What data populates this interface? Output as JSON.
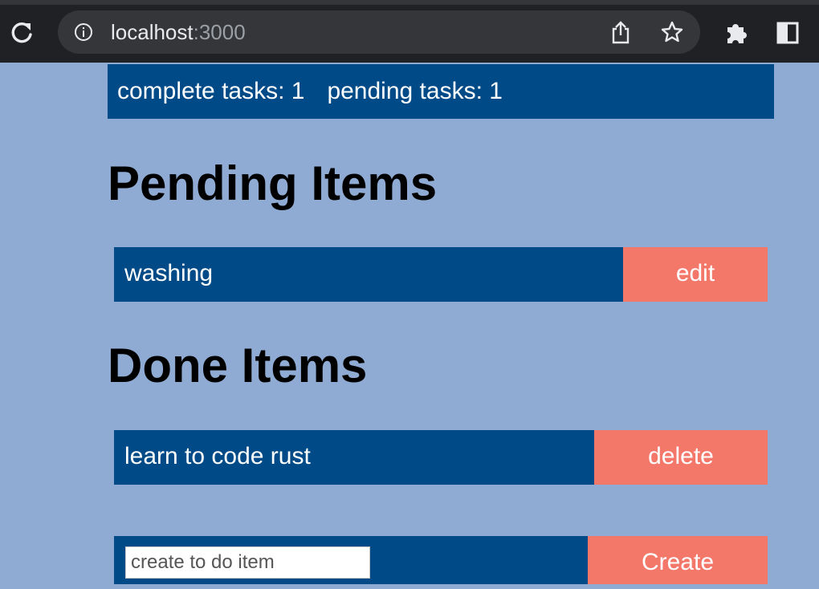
{
  "browser": {
    "url_host": "localhost",
    "url_port": ":3000"
  },
  "stats": {
    "complete_label": "complete tasks: 1",
    "pending_label": "pending tasks: 1"
  },
  "pending_section": {
    "title": "Pending Items",
    "items": [
      {
        "title": "washing",
        "action": "edit"
      }
    ]
  },
  "done_section": {
    "title": "Done Items",
    "items": [
      {
        "title": "learn to code rust",
        "action": "delete"
      }
    ]
  },
  "create": {
    "placeholder": "create to do item",
    "value": "",
    "button_label": "Create"
  },
  "colors": {
    "page_background": "#8faad3",
    "bar": "#004b87",
    "button": "#f4786a"
  }
}
